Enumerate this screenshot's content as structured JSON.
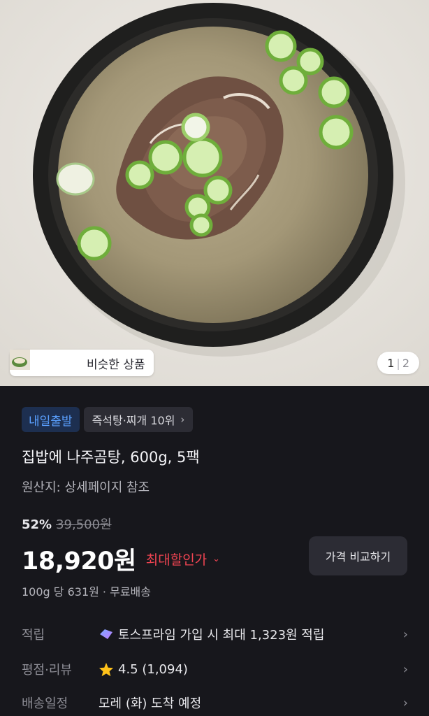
{
  "gallery": {
    "similar_label": "비슷한 상품",
    "page_current": "1",
    "page_sep": "|",
    "page_total": "2"
  },
  "badges": {
    "delivery": "내일출발",
    "rank": "즉석탕·찌개 10위"
  },
  "product": {
    "title": "집밥에 나주곰탕, 600g, 5팩",
    "origin": "원산지: 상세페이지 참조"
  },
  "pricing": {
    "discount": "52%",
    "original_price": "39,500원",
    "price": "18,920원",
    "price_tag": "최대할인가",
    "compare_button": "가격 비교하기",
    "unit_price": "100g 당 631원 · 무료배송"
  },
  "details": {
    "points_label": "적립",
    "points_value": "토스프라임 가입 시 최대 1,323원 적립",
    "rating_label": "평점·리뷰",
    "rating_value": "4.5 (1,094)",
    "shipping_label": "배송일정",
    "shipping_value": "모레 (화) 도착 예정"
  },
  "icons": {
    "rank_chevron": "chevron-right-icon",
    "price_tag_chevron": "chevron-down-icon",
    "points_icon": "prime-badge-icon",
    "rating_icon": "star-icon",
    "row_chevron": "chevron-right-icon"
  },
  "colors": {
    "panel_bg": "#17171c",
    "accent_blue": "#5aa0ff",
    "discount_red": "#f04452",
    "star": "#ffc21a",
    "chip_bg": "#2c2c34"
  }
}
